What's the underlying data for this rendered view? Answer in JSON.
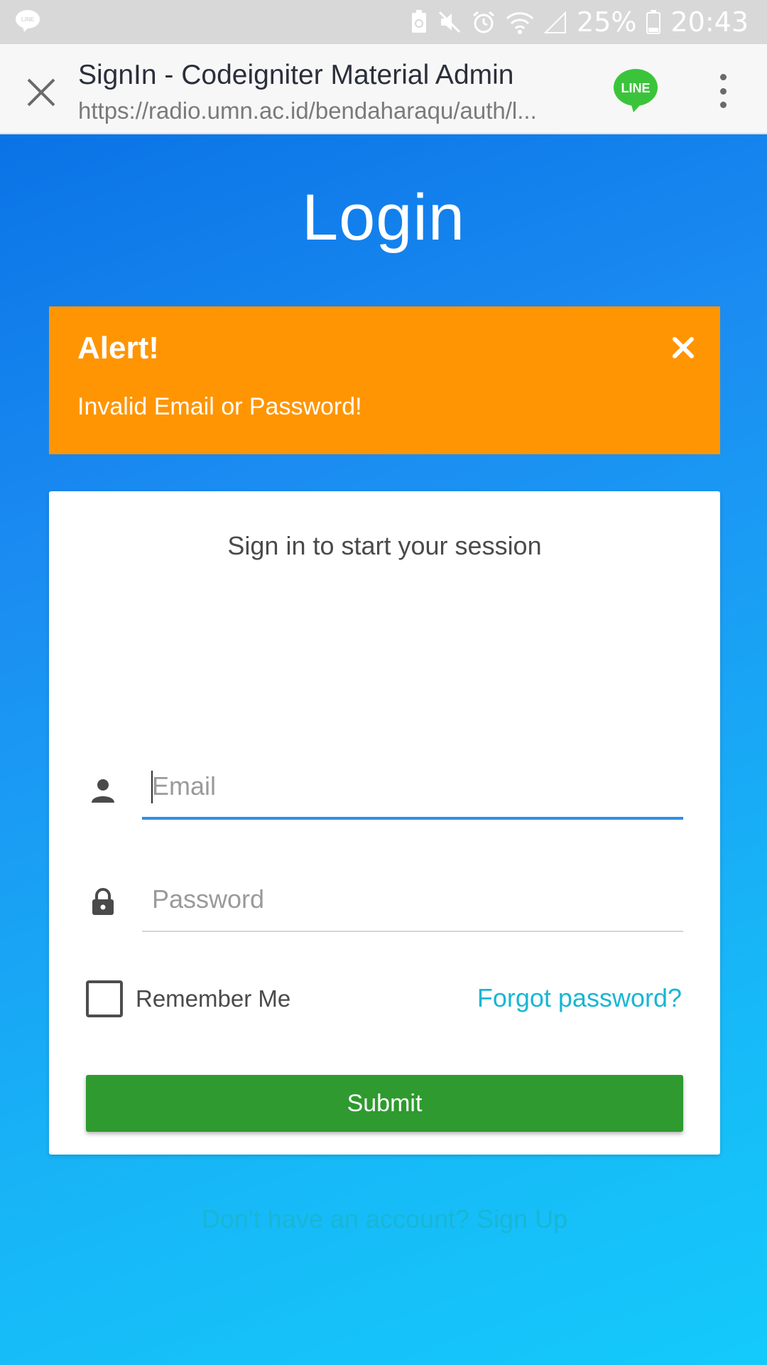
{
  "status_bar": {
    "battery_percent": "25%",
    "time": "20:43",
    "icons": [
      "line-notification-icon",
      "battery-saver-icon",
      "mute-icon",
      "alarm-icon",
      "wifi-icon",
      "signal-icon",
      "battery-icon"
    ]
  },
  "browser": {
    "title": "SignIn - Codeigniter Material Admin",
    "url": "https://radio.umn.ac.id/bendaharaqu/auth/l...",
    "logo_text": "LINE"
  },
  "page": {
    "title": "Login"
  },
  "alert": {
    "title": "Alert!",
    "message": "Invalid Email or Password!",
    "color": "#ff9503"
  },
  "form": {
    "heading": "Sign in to start your session",
    "email_placeholder": "Email",
    "email_value": "",
    "password_placeholder": "Password",
    "password_value": "",
    "remember_label": "Remember Me",
    "remember_checked": false,
    "forgot_label": "Forgot password?",
    "submit_label": "Submit",
    "signup_label": "Don't have an account? Sign Up"
  },
  "colors": {
    "accent_link": "#19b6d3",
    "submit_green": "#2e9a2f",
    "focus_blue": "#2b8fe6"
  }
}
